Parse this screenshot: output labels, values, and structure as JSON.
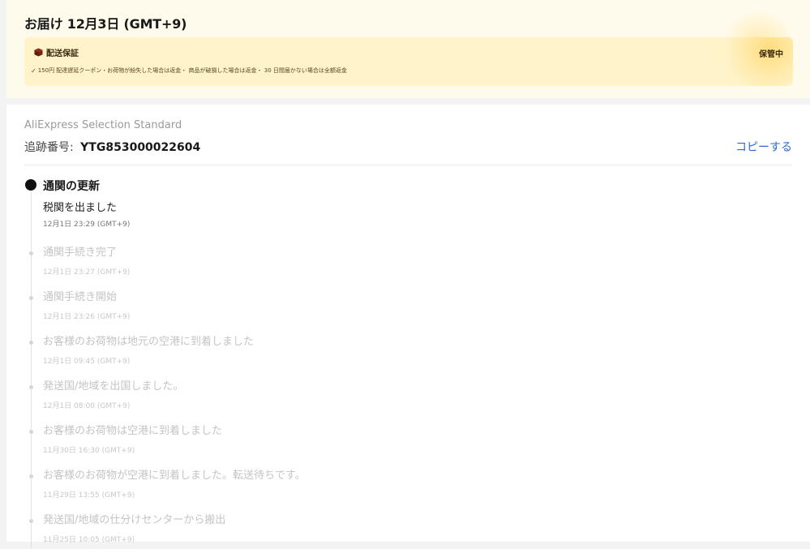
{
  "delivery": {
    "title": "お届け 12月3日 (GMT+9)",
    "guarantee_title": "配送保証",
    "guarantee_detail": "150円 配達遅延クーポン・お荷物が紛失した場合は返金・ 商品が破損した場合は返金・ 30 日間届かない場合は全額返金",
    "status": "保管中",
    "colors": {
      "card_bg": "#fffbec",
      "box_bg": "#fff3c9"
    }
  },
  "tracking": {
    "carrier": "AliExpress Selection Standard",
    "number_label": "追跡番号:",
    "number": "YTG853000022604",
    "copy_label": "コピーする",
    "link_color": "#2a6bd8"
  },
  "timeline": {
    "current": {
      "title": "通関の更新",
      "detail": "税関を出ました",
      "time": "12月1日 23:29 (GMT+9)"
    },
    "events": [
      {
        "status": "通関手続き完了",
        "time": "12月1日 23:27 (GMT+9)"
      },
      {
        "status": "通関手続き開始",
        "time": "12月1日 23:26 (GMT+9)"
      },
      {
        "status": "お客様のお荷物は地元の空港に到着しました",
        "time": "12月1日 09:45 (GMT+9)"
      },
      {
        "status": "発送国/地域を出国しました。",
        "time": "12月1日 08:00 (GMT+9)"
      },
      {
        "status": "お客様のお荷物は空港に到着しました",
        "time": "11月30日 16:30 (GMT+9)"
      },
      {
        "status": "お客様のお荷物が空港に到着しました。転送待ちです。",
        "time": "11月29日 13:55 (GMT+9)"
      },
      {
        "status": "発送国/地域の仕分けセンターから搬出",
        "time": "11月25日 10:05 (GMT+9)"
      }
    ]
  }
}
